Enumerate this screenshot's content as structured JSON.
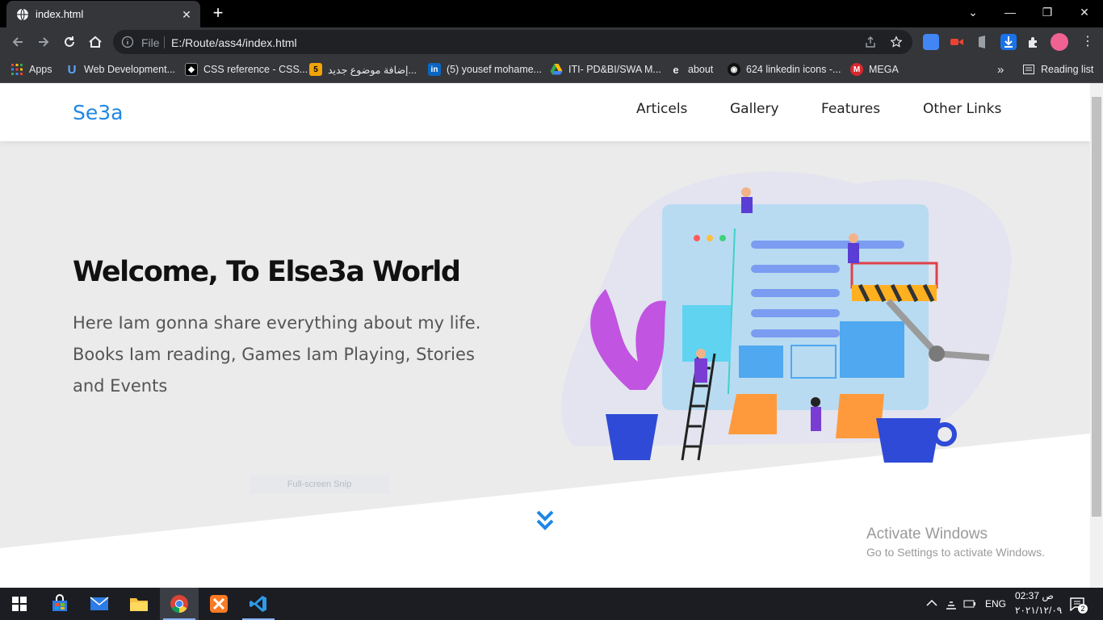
{
  "browser": {
    "tab": {
      "title": "index.html"
    },
    "omnibox": {
      "scheme_label": "File",
      "url": "E:/Route/ass4/index.html"
    },
    "bookmarks": [
      {
        "label": "Apps",
        "icon": "apps-grid-icon"
      },
      {
        "label": "Web Development...",
        "icon": "udemy-icon"
      },
      {
        "label": "CSS reference - CSS...",
        "icon": "mdn-icon"
      },
      {
        "label": "إضافة موضوع جديد...",
        "icon": "html5-icon"
      },
      {
        "label": "(5) yousef mohame...",
        "icon": "linkedin-icon"
      },
      {
        "label": "ITI- PD&BI/SWA M...",
        "icon": "google-drive-icon"
      },
      {
        "label": "about",
        "icon": "about-icon"
      },
      {
        "label": "624 linkedin icons -...",
        "icon": "icons-site-icon"
      },
      {
        "label": "MEGA",
        "icon": "mega-icon"
      }
    ],
    "overflow_label": "»",
    "reading_list": "Reading list"
  },
  "site": {
    "logo": "Se3a",
    "nav": [
      "Articels",
      "Gallery",
      "Features",
      "Other Links"
    ],
    "hero": {
      "title": "Welcome, To Else3a World",
      "text": "Here Iam gonna share everything about my life. Books Iam reading, Games Iam Playing, Stories and Events"
    },
    "snip_overlay": "Full-screen Snip"
  },
  "watermark": {
    "title": "Activate Windows",
    "subtitle": "Go to Settings to activate Windows."
  },
  "taskbar": {
    "language": "ENG",
    "time": "02:37 ص",
    "date": "٢٠٢١/١٢/٠٩",
    "notification_count": "2"
  },
  "colors": {
    "accent": "#1e88e5",
    "hero_bg": "#ebebeb"
  }
}
